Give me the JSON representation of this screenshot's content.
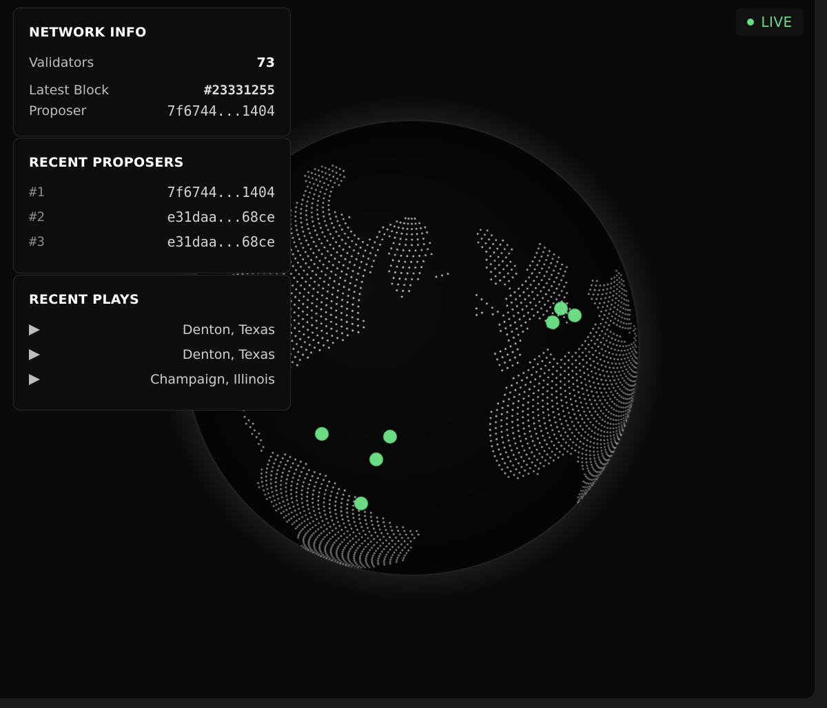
{
  "status": {
    "label": "LIVE",
    "color": "#6bdc84"
  },
  "network_info": {
    "title": "NETWORK INFO",
    "validators_label": "Validators",
    "validators_value": "73",
    "latest_block_label": "Latest Block",
    "latest_block_value": "#23331255",
    "proposer_label": "Proposer",
    "proposer_value": "7f6744...1404"
  },
  "recent_proposers": {
    "title": "RECENT PROPOSERS",
    "items": [
      {
        "rank": "#1",
        "address": "7f6744...1404"
      },
      {
        "rank": "#2",
        "address": "e31daa...68ce"
      },
      {
        "rank": "#3",
        "address": "e31daa...68ce"
      }
    ]
  },
  "recent_plays": {
    "title": "RECENT PLAYS",
    "play_icon": "play-icon",
    "items": [
      {
        "location": "Denton, Texas"
      },
      {
        "location": "Denton, Texas"
      },
      {
        "location": "Champaign, Illinois"
      }
    ]
  },
  "globe": {
    "dot_color": "#e6e6e6",
    "marker_color": "#6bdc84",
    "markers": [
      {
        "place": "Denton, Texas"
      },
      {
        "place": "Champaign, Illinois"
      },
      {
        "place": "Georgia"
      },
      {
        "place": "Florida"
      },
      {
        "place": "Central Europe"
      },
      {
        "place": "Central Europe"
      },
      {
        "place": "Central Europe"
      }
    ]
  }
}
